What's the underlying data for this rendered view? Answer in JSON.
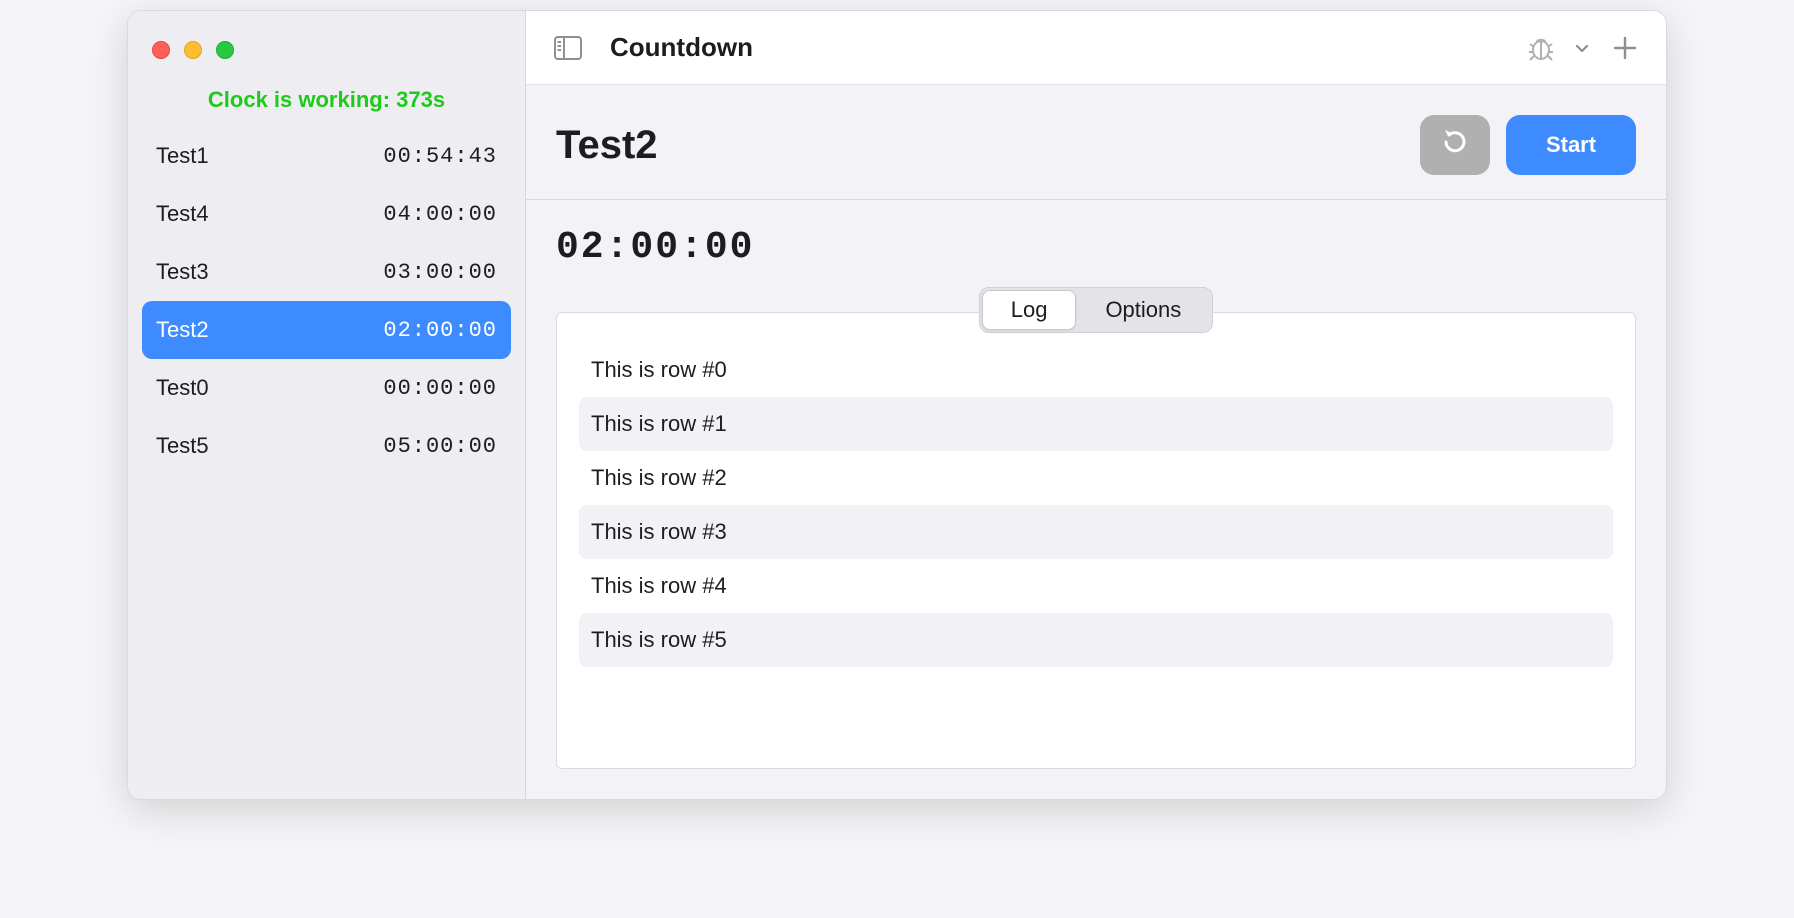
{
  "sidebar": {
    "clock_status": "Clock is working: 373s",
    "items": [
      {
        "name": "Test1",
        "time": "00:54:43",
        "selected": false
      },
      {
        "name": "Test4",
        "time": "04:00:00",
        "selected": false
      },
      {
        "name": "Test3",
        "time": "03:00:00",
        "selected": false
      },
      {
        "name": "Test2",
        "time": "02:00:00",
        "selected": true
      },
      {
        "name": "Test0",
        "time": "00:00:00",
        "selected": false
      },
      {
        "name": "Test5",
        "time": "05:00:00",
        "selected": false
      }
    ]
  },
  "toolbar": {
    "title": "Countdown"
  },
  "detail": {
    "title": "Test2",
    "start_label": "Start",
    "timer": "02:00:00",
    "tabs": {
      "log": "Log",
      "options": "Options",
      "active": "log"
    },
    "log_rows": [
      "This is row #0",
      "This is row #1",
      "This is row #2",
      "This is row #3",
      "This is row #4",
      "This is row #5"
    ]
  }
}
